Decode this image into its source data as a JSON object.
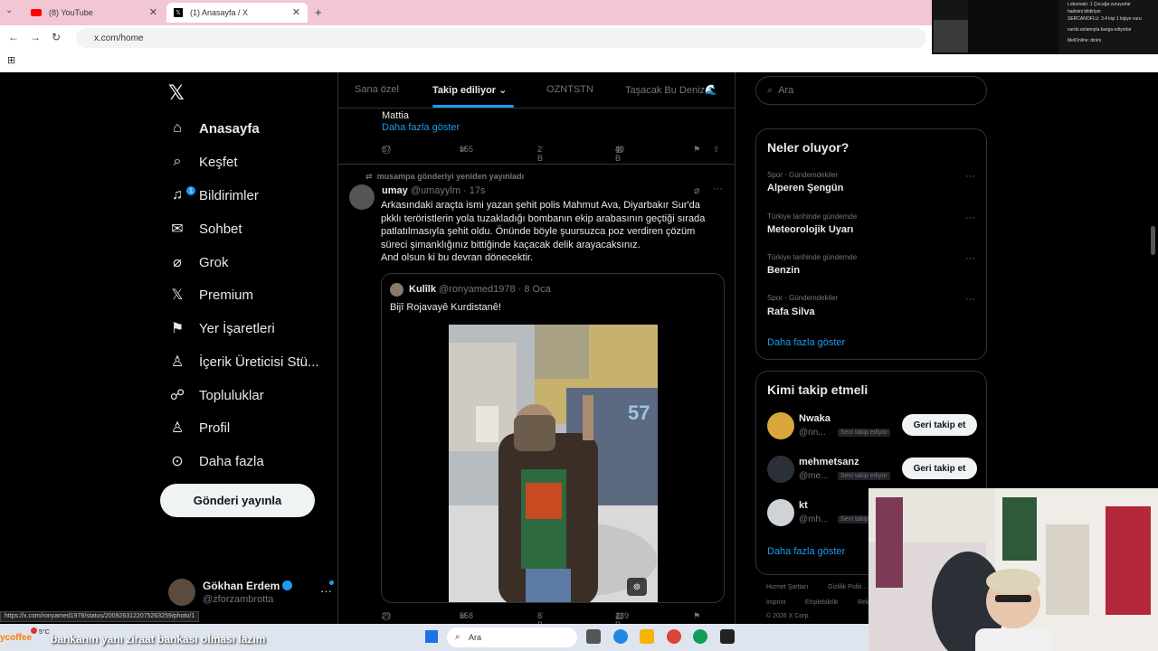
{
  "browser": {
    "tabs": [
      {
        "title": "(8) YouTube",
        "active": false
      },
      {
        "title": "(1) Anasayfa / X",
        "active": true
      }
    ],
    "url": "x.com/home",
    "status_url": "https://x.com/ronyamed1978/status/2009263122075263259/photo/1"
  },
  "stream_chat": {
    "lines": [
      "Lobumalo: 1 Çocuğa vuruyorlar",
      "hadisini bildiriyor",
      "SERCANOFLU: 3.4 kişi 1 kişiye vuru",
      "vurdu anlamıyla kavga ediyorlar",
      "MelOnline: dinini"
    ]
  },
  "sidebar": {
    "items": [
      {
        "label": "Anasayfa",
        "icon": "home-icon",
        "active": true
      },
      {
        "label": "Keşfet",
        "icon": "search-icon",
        "active": false
      },
      {
        "label": "Bildirimler",
        "icon": "bell-icon",
        "active": false,
        "badge": "1"
      },
      {
        "label": "Sohbet",
        "icon": "mail-icon",
        "active": false
      },
      {
        "label": "Grok",
        "icon": "grok-icon",
        "active": false
      },
      {
        "label": "Premium",
        "icon": "x-logo-icon",
        "active": false
      },
      {
        "label": "Yer İşaretleri",
        "icon": "bookmark-icon",
        "active": false
      },
      {
        "label": "İçerik Üreticisi Stü...",
        "icon": "creator-icon",
        "active": false
      },
      {
        "label": "Topluluklar",
        "icon": "communities-icon",
        "active": false
      },
      {
        "label": "Profil",
        "icon": "profile-icon",
        "active": false
      },
      {
        "label": "Daha fazla",
        "icon": "more-circle-icon",
        "active": false
      }
    ],
    "post_button": "Gönderi yayınla",
    "profile": {
      "name": "Gökhan Erdem",
      "handle": "@zforzambrotta"
    }
  },
  "feed": {
    "tabs": [
      {
        "label": "Sana özel",
        "active": false
      },
      {
        "label": "Takip ediliyor",
        "active": true
      },
      {
        "label": "OZNTSTN",
        "active": false
      },
      {
        "label": "Taşacak Bu Deniz🌊",
        "active": false
      }
    ],
    "prev_post": {
      "text": "Mattia",
      "show_more": "Daha fazla göster",
      "replies": "87",
      "reposts": "555",
      "likes": "2 B",
      "views": "40 B"
    },
    "post": {
      "repost_label": "musampa gönderiyi yeniden yayınladı",
      "name": "umay",
      "handle": "@umayylm",
      "time": "· 17s",
      "text_lines": [
        "Arkasındaki araçta ismi yazan şehit polis Mahmut Ava, Diyarbakır Sur'da",
        "pkklı teröristlerin yola tuzakladığı bombanın ekip arabasının geçtiği sırada",
        "patlatılmasıyla şehit oldu. Önünde böyle şuursuzca poz verdiren çözüm",
        "süreci şimanklığınız bittiğinde kaçacak delik arayacaksınız.",
        "And olsun ki bu devran dönecektir."
      ],
      "quote": {
        "name": "Kulîlk",
        "handle": "@ronyamed1978",
        "time": "· 8 Oca",
        "text": "Bijî Rojavayê Kurdistanê!"
      },
      "replies": "29",
      "reposts": "558",
      "likes": "8 B",
      "views": "239 B"
    }
  },
  "right": {
    "search_placeholder": "Ara",
    "trends_title": "Neler oluyor?",
    "trends": [
      {
        "meta": "Spor · Gündemdekiler",
        "name": "Alperen Şengün"
      },
      {
        "meta": "Türkiye tarihinde gündemde",
        "name": "Meteorolojik Uyarı"
      },
      {
        "meta": "Türkiye tarihinde gündemde",
        "name": "Benzin"
      },
      {
        "meta": "Spor · Gündemdekiler",
        "name": "Rafa Silva"
      }
    ],
    "trends_more": "Daha fazla göster",
    "who_title": "Kimi takip etmeli",
    "who": [
      {
        "name": "Nwaka",
        "handle": "@nn...",
        "tag": "Seni takip ediyor",
        "button": "Geri takip et"
      },
      {
        "name": "mehmetsanz",
        "handle": "@me...",
        "tag": "Seni takip ediyor",
        "button": "Geri takip et"
      },
      {
        "name": "kt",
        "handle": "@mh...",
        "tag": "Seni takip",
        "button": ""
      }
    ],
    "who_more": "Daha fazla göster",
    "footer": [
      "Hizmet Şartları",
      "Gizlilik Politi...",
      "Imprint",
      "Erişilebilirlik",
      "Rek...",
      "© 2026 X Corp."
    ]
  },
  "taskbar": {
    "ticker_brand": "ycoffee",
    "ticker": "bankanın yanı ziraat bankası olması lazım",
    "weather": "5°C",
    "search": "Ara"
  }
}
